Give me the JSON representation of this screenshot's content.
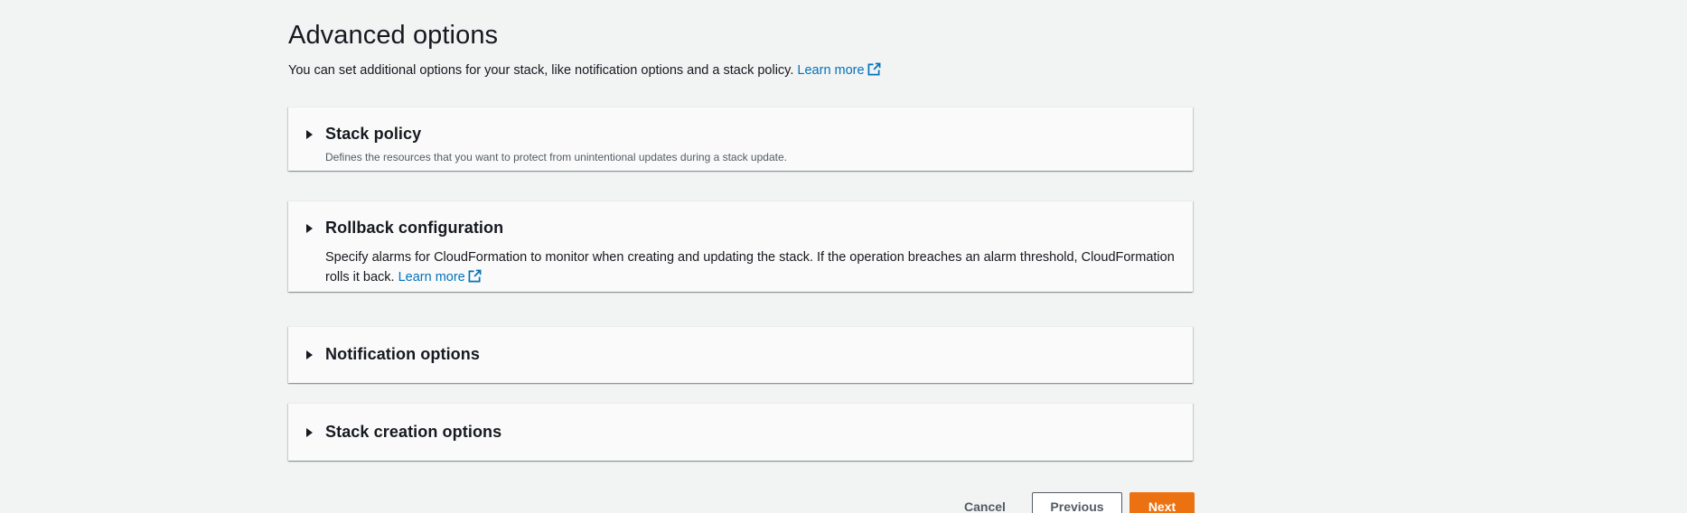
{
  "section": {
    "title": "Advanced options",
    "description": "You can set additional options for your stack, like notification options and a stack policy.",
    "learn_more": "Learn more"
  },
  "panels": [
    {
      "title": "Stack policy",
      "description": "Defines the resources that you want to protect from unintentional updates during a stack update."
    },
    {
      "title": "Rollback configuration",
      "description": "Specify alarms for CloudFormation to monitor when creating and updating the stack. If the operation breaches an alarm threshold, CloudFormation rolls it back.",
      "learn_more": "Learn more"
    },
    {
      "title": "Notification options"
    },
    {
      "title": "Stack creation options"
    }
  ],
  "actions": {
    "cancel": "Cancel",
    "previous": "Previous",
    "next": "Next"
  },
  "icons": {
    "expand": "caret-right-icon",
    "external_link": "external-link-icon"
  },
  "colors": {
    "link": "#0073bb",
    "primary_button": "#ec7211",
    "background": "#f2f3f3",
    "panel_background": "#fafafa"
  }
}
